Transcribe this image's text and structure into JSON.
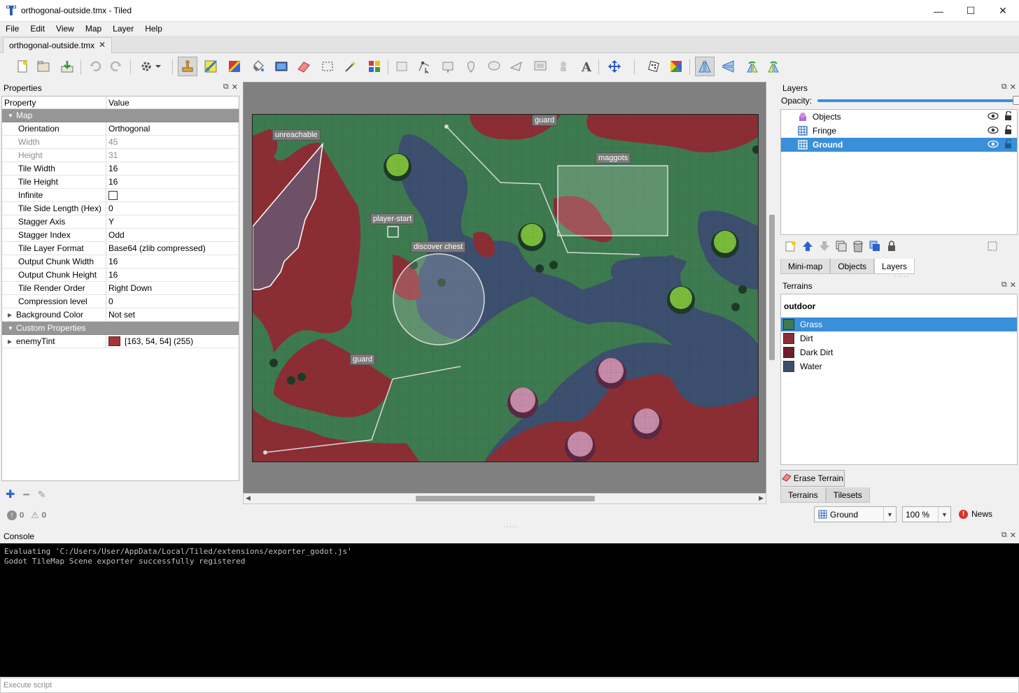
{
  "window": {
    "title": "orthogonal-outside.tmx - Tiled",
    "minimize": "—",
    "maximize": "☐",
    "close": "✕"
  },
  "menu": [
    "File",
    "Edit",
    "View",
    "Map",
    "Layer",
    "Help"
  ],
  "doc_tab": {
    "label": "orthogonal-outside.tmx",
    "close": "✕"
  },
  "properties": {
    "panel_title": "Properties",
    "col_property": "Property",
    "col_value": "Value",
    "group_map": "Map",
    "rows": [
      {
        "k": "Orientation",
        "v": "Orthogonal"
      },
      {
        "k": "Width",
        "v": "45"
      },
      {
        "k": "Height",
        "v": "31"
      },
      {
        "k": "Tile Width",
        "v": "16"
      },
      {
        "k": "Tile Height",
        "v": "16"
      },
      {
        "k": "Infinite",
        "v": ""
      },
      {
        "k": "Tile Side Length (Hex)",
        "v": "0"
      },
      {
        "k": "Stagger Axis",
        "v": "Y"
      },
      {
        "k": "Stagger Index",
        "v": "Odd"
      },
      {
        "k": "Tile Layer Format",
        "v": "Base64 (zlib compressed)"
      },
      {
        "k": "Output Chunk Width",
        "v": "16"
      },
      {
        "k": "Output Chunk Height",
        "v": "16"
      },
      {
        "k": "Tile Render Order",
        "v": "Right Down"
      },
      {
        "k": "Compression level",
        "v": "0"
      },
      {
        "k": "Background Color",
        "v": "Not set"
      }
    ],
    "group_custom": "Custom Properties",
    "custom_key": "enemyTint",
    "custom_value": "[163, 54, 54] (255)",
    "custom_color": "#a33636",
    "errors": "0",
    "warnings": "0"
  },
  "map_labels": {
    "guard_top": "guard",
    "unreachable": "unreachable",
    "maggots": "maggots",
    "player_start": "player-start",
    "discover_chest": "discover chest",
    "guard_bottom": "guard"
  },
  "layers": {
    "panel_title": "Layers",
    "opacity_label": "Opacity:",
    "items": [
      {
        "name": "Objects",
        "selected": false
      },
      {
        "name": "Fringe",
        "selected": false
      },
      {
        "name": "Ground",
        "selected": true
      }
    ],
    "tabs": [
      "Mini-map",
      "Objects",
      "Layers"
    ],
    "active_tab": "Layers"
  },
  "terrains": {
    "panel_title": "Terrains",
    "tileset": "outdoor",
    "items": [
      {
        "name": "Grass",
        "color": "#3d7a4f",
        "selected": true
      },
      {
        "name": "Dirt",
        "color": "#8b2e34",
        "selected": false
      },
      {
        "name": "Dark Dirt",
        "color": "#6e1d2b",
        "selected": false
      },
      {
        "name": "Water",
        "color": "#3c4f6e",
        "selected": false
      }
    ],
    "erase_label": "Erase Terrain",
    "tabs": [
      "Terrains",
      "Tilesets"
    ],
    "active_tab": "Tilesets"
  },
  "statusbar": {
    "layer_combo": "Ground",
    "zoom": "100 %",
    "news": "News"
  },
  "console": {
    "title": "Console",
    "lines": [
      "Evaluating 'C:/Users/User/AppData/Local/Tiled/extensions/exporter_godot.js'",
      "Godot TileMap Scene exporter successfully registered"
    ],
    "input_placeholder": "Execute script"
  },
  "colors": {
    "grass": "#3d7a4f",
    "dirt": "#8b2e34",
    "water": "#3c4f6e",
    "selection": "#3a8fd9"
  }
}
